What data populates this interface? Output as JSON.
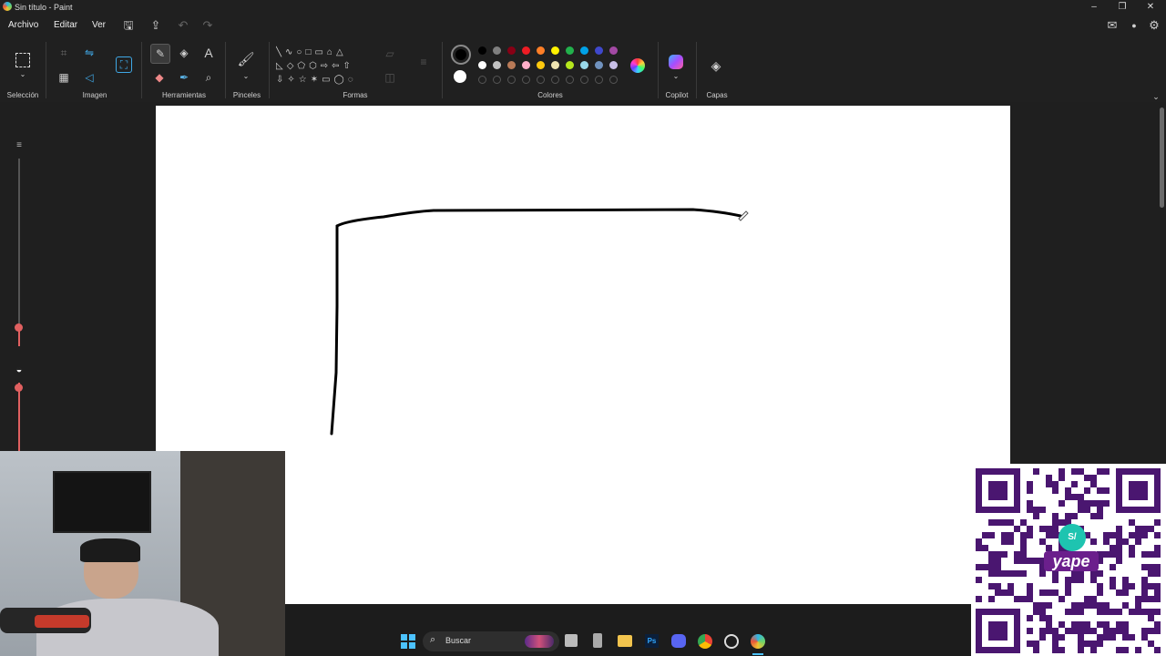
{
  "window": {
    "title": "Sin título - Paint"
  },
  "menu": {
    "file": "Archivo",
    "edit": "Editar",
    "view": "Ver"
  },
  "ribbon": {
    "groups": {
      "selection": "Selección",
      "image": "Imagen",
      "tools": "Herramientas",
      "brushes": "Pinceles",
      "shapes": "Formas",
      "colors": "Colores",
      "copilot": "Copilot",
      "layers": "Capas"
    },
    "palette_row1": [
      "#000000",
      "#7f7f7f",
      "#880015",
      "#ed1c24",
      "#ff7f27",
      "#fff200",
      "#22b14c",
      "#00a2e8",
      "#3f48cc",
      "#a349a4"
    ],
    "palette_row2": [
      "#ffffff",
      "#c3c3c3",
      "#b97a57",
      "#ffaec9",
      "#ffc90e",
      "#efe4b0",
      "#b5e61d",
      "#99d9ea",
      "#7092be",
      "#c8bfe7"
    ],
    "primary_color": "#000000",
    "secondary_color": "#ffffff",
    "accent": "#e06060"
  },
  "taskbar": {
    "search_placeholder": "Buscar"
  },
  "overlay": {
    "qr_brand": "yape",
    "qr_badge": "S/"
  }
}
